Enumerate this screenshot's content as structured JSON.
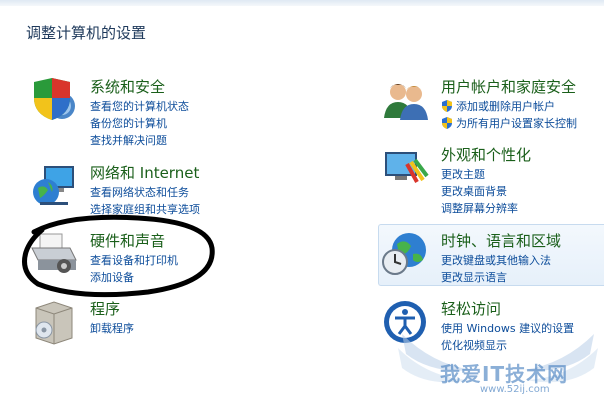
{
  "page": {
    "title": "调整计算机的设置"
  },
  "left": [
    {
      "id": "system",
      "title": "系统和安全",
      "icon": "shield-system-icon",
      "links": [
        "查看您的计算机状态",
        "备份您的计算机",
        "查找并解决问题"
      ]
    },
    {
      "id": "network",
      "title": "网络和 Internet",
      "icon": "network-globe-icon",
      "links": [
        "查看网络状态和任务",
        "选择家庭组和共享选项"
      ]
    },
    {
      "id": "hardware",
      "title": "硬件和声音",
      "icon": "printer-icon",
      "links": [
        "查看设备和打印机",
        "添加设备"
      ]
    },
    {
      "id": "programs",
      "title": "程序",
      "icon": "programs-box-icon",
      "links": [
        "卸载程序"
      ]
    }
  ],
  "right": [
    {
      "id": "users",
      "title": "用户帐户和家庭安全",
      "icon": "users-icon",
      "links": [
        "添加或删除用户帐户",
        "为所有用户设置家长控制"
      ]
    },
    {
      "id": "appearance",
      "title": "外观和个性化",
      "icon": "display-paint-icon",
      "links": [
        "更改主题",
        "更改桌面背景",
        "调整屏幕分辨率"
      ]
    },
    {
      "id": "clock",
      "title": "时钟、语言和区域",
      "icon": "clock-globe-icon",
      "links": [
        "更改键盘或其他输入法",
        "更改显示语言"
      ]
    },
    {
      "id": "access",
      "title": "轻松访问",
      "icon": "ease-of-access-icon",
      "links": [
        "使用 Windows 建议的设置",
        "优化视频显示"
      ]
    }
  ],
  "watermark": {
    "text": "我爱IT技术网",
    "url": "www.52ij.com"
  }
}
